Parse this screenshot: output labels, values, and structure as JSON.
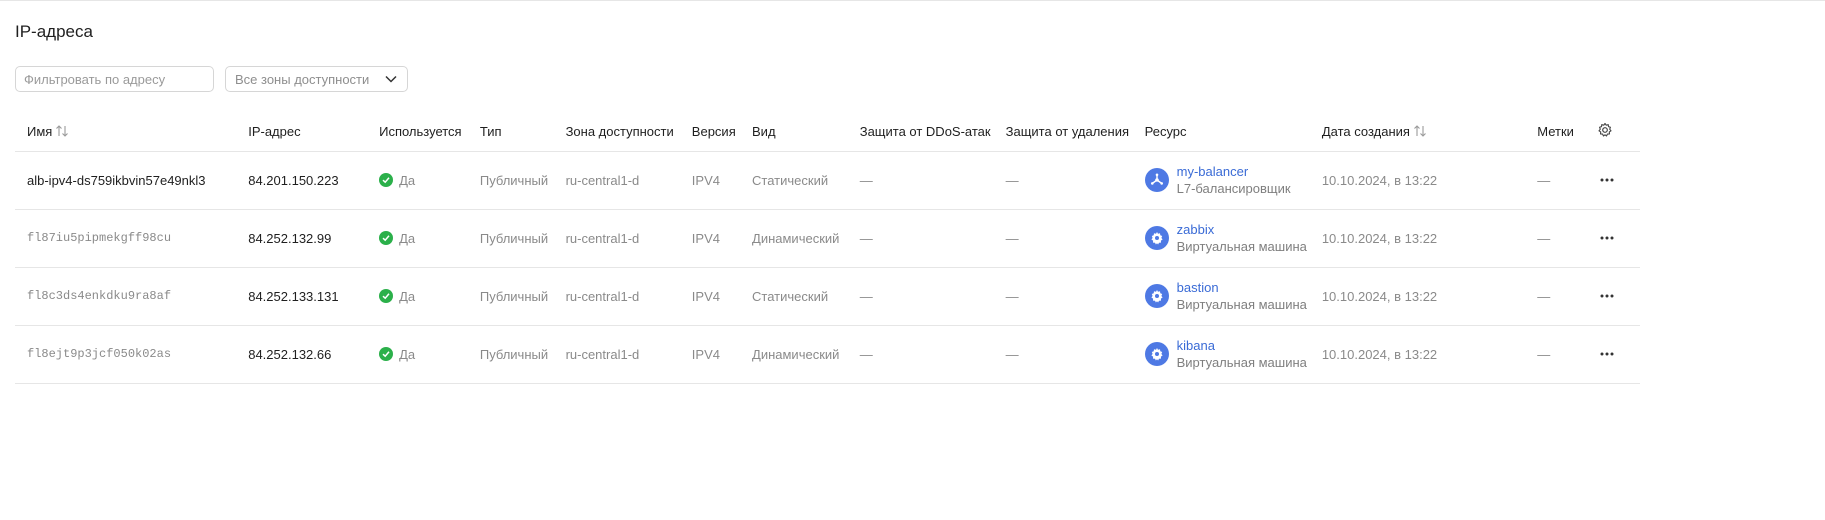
{
  "page": {
    "title": "IP-адреса"
  },
  "filters": {
    "search_placeholder": "Фильтровать по адресу",
    "search_value": "",
    "zone_select_value": "Все зоны доступности"
  },
  "columns": {
    "name": "Имя",
    "ip": "IP-адрес",
    "used": "Используется",
    "type": "Тип",
    "zone": "Зона доступности",
    "version": "Версия",
    "kind": "Вид",
    "ddos": "Защита от DDoS-атак",
    "deletion": "Защита от удаления",
    "resource": "Ресурс",
    "created": "Дата создания",
    "labels": "Метки"
  },
  "rows": [
    {
      "name": "alb-ipv4-ds759ikbvin57e49nkl3",
      "ip": "84.201.150.223",
      "used": "Да",
      "type": "Публичный",
      "zone": "ru-central1-d",
      "version": "IPV4",
      "kind": "Статический",
      "ddos": "—",
      "deletion": "—",
      "resource_name": "my-balancer",
      "resource_type": "L7-балансировщик",
      "resource_icon": "load-balancer-icon",
      "created": "10.10.2024, в 13:22",
      "labels": "—"
    },
    {
      "name": "fl87iu5pipmekgff98cu",
      "ip": "84.252.132.99",
      "used": "Да",
      "type": "Публичный",
      "zone": "ru-central1-d",
      "version": "IPV4",
      "kind": "Динамический",
      "ddos": "—",
      "deletion": "—",
      "resource_name": "zabbix",
      "resource_type": "Виртуальная машина",
      "resource_icon": "vm-icon",
      "created": "10.10.2024, в 13:22",
      "labels": "—"
    },
    {
      "name": "fl8c3ds4enkdku9ra8af",
      "ip": "84.252.133.131",
      "used": "Да",
      "type": "Публичный",
      "zone": "ru-central1-d",
      "version": "IPV4",
      "kind": "Статический",
      "ddos": "—",
      "deletion": "—",
      "resource_name": "bastion",
      "resource_type": "Виртуальная машина",
      "resource_icon": "vm-icon",
      "created": "10.10.2024, в 13:22",
      "labels": "—"
    },
    {
      "name": "fl8ejt9p3jcf050k02as",
      "ip": "84.252.132.66",
      "used": "Да",
      "type": "Публичный",
      "zone": "ru-central1-d",
      "version": "IPV4",
      "kind": "Динамический",
      "ddos": "—",
      "deletion": "—",
      "resource_name": "kibana",
      "resource_type": "Виртуальная машина",
      "resource_icon": "vm-icon",
      "created": "10.10.2024, в 13:22",
      "labels": "—"
    }
  ],
  "colors": {
    "accent": "#3a6bd6",
    "success": "#2bb04a",
    "resource_icon_bg": "#4e79e4"
  }
}
